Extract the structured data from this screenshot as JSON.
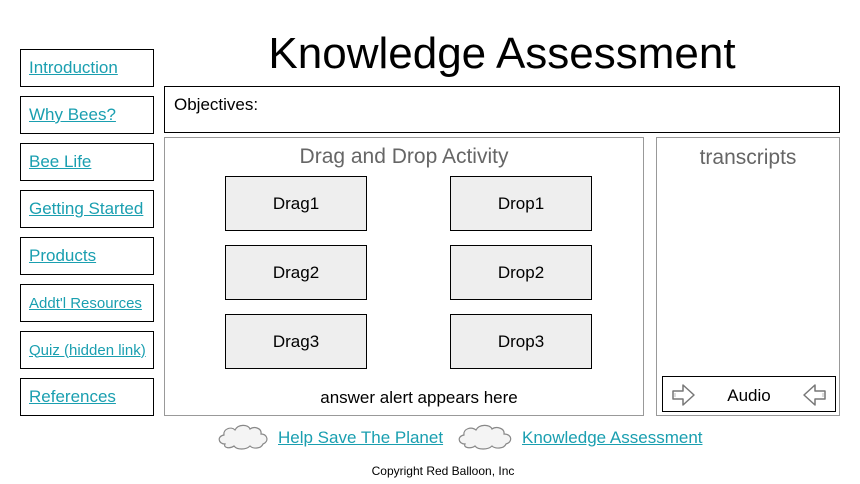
{
  "page": {
    "title": "Knowledge Assessment"
  },
  "sidebar": {
    "items": [
      {
        "label": "Introduction"
      },
      {
        "label": "Why Bees?"
      },
      {
        "label": "Bee Life"
      },
      {
        "label": "Getting Started"
      },
      {
        "label": "Products"
      },
      {
        "label": "Addt'l Resources"
      },
      {
        "label": "Quiz (hidden link)"
      },
      {
        "label": "References"
      }
    ]
  },
  "objectives": {
    "label": "Objectives:"
  },
  "activity": {
    "title": "Drag and Drop Activity",
    "drags": [
      "Drag1",
      "Drag2",
      "Drag3"
    ],
    "drops": [
      "Drop1",
      "Drop2",
      "Drop3"
    ],
    "answer_alert": "answer alert appears here"
  },
  "transcripts": {
    "title": "transcripts",
    "audio_label": "Audio",
    "icons": {
      "left": "arrow-left-icon",
      "right": "arrow-right-icon"
    }
  },
  "footer": {
    "links": [
      {
        "label": "Help Save The Planet",
        "icon": "cloud-icon"
      },
      {
        "label": "Knowledge Assessment",
        "icon": "cloud-icon"
      }
    ],
    "copyright": "Copyright Red Balloon, Inc"
  },
  "colors": {
    "link": "#1a9fb0",
    "tile_bg": "#eeeeee",
    "muted_text": "#666666"
  }
}
